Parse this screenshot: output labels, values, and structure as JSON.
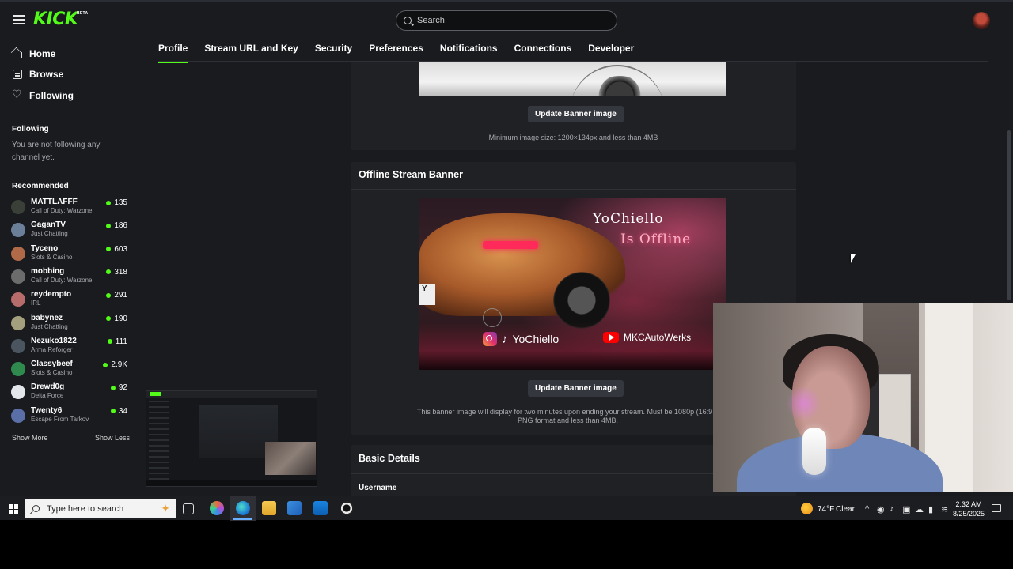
{
  "app": {
    "logo_text": "KICK",
    "logo_badge": "BETA"
  },
  "search": {
    "placeholder": "Search"
  },
  "nav": [
    {
      "label": "Home",
      "icon": "home-icon"
    },
    {
      "label": "Browse",
      "icon": "browse-icon"
    },
    {
      "label": "Following",
      "icon": "heart-icon"
    }
  ],
  "sidebar": {
    "following_heading": "Following",
    "following_empty": "You are not following any channel yet.",
    "recommended_heading": "Recommended",
    "recommended": [
      {
        "name": "MATTLAFFF",
        "category": "Call of Duty: Warzone",
        "viewers": "135",
        "avatar_color": "#3a3f38"
      },
      {
        "name": "GaganTV",
        "category": "Just Chatting",
        "viewers": "186",
        "avatar_color": "#6b7f99"
      },
      {
        "name": "Tyceno",
        "category": "Slots & Casino",
        "viewers": "603",
        "avatar_color": "#b06a48"
      },
      {
        "name": "mobbing",
        "category": "Call of Duty: Warzone",
        "viewers": "318",
        "avatar_color": "#6c6c6c"
      },
      {
        "name": "reydempto",
        "category": "IRL",
        "viewers": "291",
        "avatar_color": "#b86b6b"
      },
      {
        "name": "babynez",
        "category": "Just Chatting",
        "viewers": "190",
        "avatar_color": "#a4a07e"
      },
      {
        "name": "Nezuko1822",
        "category": "Arma Reforger",
        "viewers": "111",
        "avatar_color": "#4a5560"
      },
      {
        "name": "Classybeef",
        "category": "Slots & Casino",
        "viewers": "2.9K",
        "avatar_color": "#2f8a4e"
      },
      {
        "name": "Drewd0g",
        "category": "Delta Force",
        "viewers": "92",
        "avatar_color": "#e3e6ea"
      },
      {
        "name": "Twenty6",
        "category": "Escape From Tarkov",
        "viewers": "34",
        "avatar_color": "#5a6fa8"
      }
    ],
    "show_more": "Show More",
    "show_less": "Show Less"
  },
  "tabs": [
    {
      "label": "Profile",
      "active": true
    },
    {
      "label": "Stream URL and Key",
      "active": false
    },
    {
      "label": "Security",
      "active": false
    },
    {
      "label": "Preferences",
      "active": false
    },
    {
      "label": "Notifications",
      "active": false
    },
    {
      "label": "Connections",
      "active": false
    },
    {
      "label": "Developer",
      "active": false
    }
  ],
  "banner_section": {
    "button_label": "Update Banner image",
    "hint": "Minimum image size: 1200×134px and less than 4MB"
  },
  "offline_section": {
    "title": "Offline Stream Banner",
    "banner_text_line1": "YoChiello",
    "banner_text_line2": "Is Offline",
    "banner_plate": "Y",
    "social_tiktok": "YoChiello",
    "social_youtube": "MKCAutoWerks",
    "button_label": "Update Banner image",
    "hint_line1": "This banner image will display for two minutes upon ending your stream. Must be 1080p (16:9 aspe",
    "hint_line2": "PNG format and less than 4MB."
  },
  "basic_details": {
    "title": "Basic Details",
    "username_label": "Username"
  },
  "taskbar": {
    "search_placeholder": "Type here to search",
    "weather_temp": "74°F",
    "weather_condition": "Clear",
    "time": "2:32 AM",
    "date": "8/25/2025"
  },
  "colors": {
    "accent": "#53fc18",
    "background": "#191b1f",
    "panel": "#1f2125"
  }
}
